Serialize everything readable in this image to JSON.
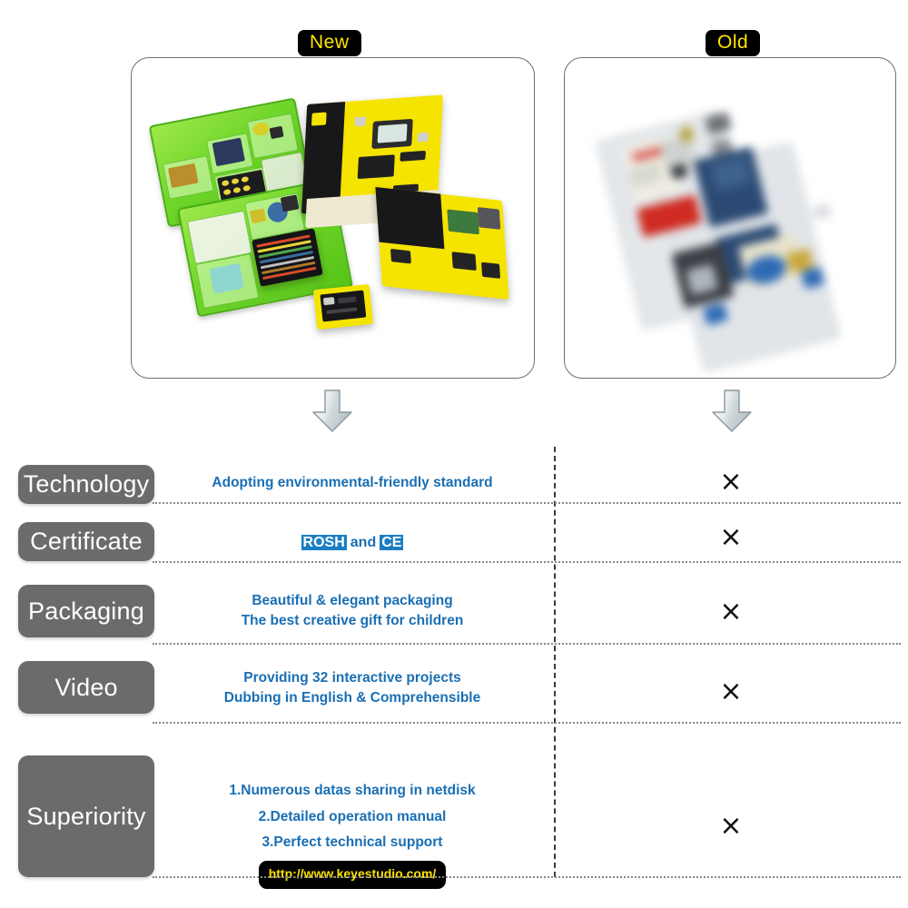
{
  "headers": {
    "new_label": "New",
    "old_label": "Old"
  },
  "photos": {
    "new_alt": "new-product-photo",
    "old_alt": "old-product-photo"
  },
  "arrows": {
    "new_icon": "down-arrow-icon",
    "old_icon": "down-arrow-icon"
  },
  "table": {
    "x_mark": "×",
    "rows": [
      {
        "category": "Technology",
        "lines": [
          "Adopting environmental-friendly standard"
        ],
        "old_value": "×"
      },
      {
        "category": "Certificate",
        "lines": [],
        "cert_rosh": "ROSH",
        "cert_and": "and",
        "cert_ce": "CE",
        "old_value": "×"
      },
      {
        "category": "Packaging",
        "lines": [
          "Beautiful & elegant packaging",
          "The best creative gift for children"
        ],
        "old_value": "×"
      },
      {
        "category": "Video",
        "lines": [
          "Providing 32 interactive projects",
          "Dubbing in English & Comprehensible"
        ],
        "old_value": "×"
      },
      {
        "category": "Superiority",
        "lines": [
          "1.Numerous datas sharing in netdisk",
          "2.Detailed operation manual",
          "3.Perfect technical support"
        ],
        "url": "http://www.keyestudio.com/",
        "old_value": "×"
      }
    ]
  },
  "colors": {
    "badge_bg": "#000000",
    "badge_text": "#ffe400",
    "category_bg": "#6b6b6b",
    "body_blue": "#1a6fb4",
    "highlight_blue": "#1a7ec4",
    "divider_gray": "#8a8a8a"
  }
}
